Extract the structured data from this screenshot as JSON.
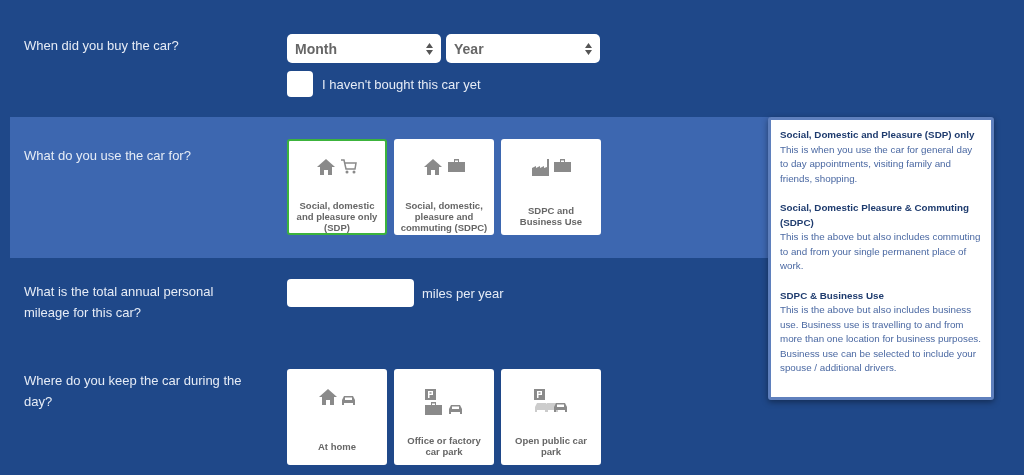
{
  "questions": [
    {
      "kind": "date",
      "label": "When did you buy the car?",
      "highlighted": false,
      "selects": [
        {
          "value": "Month"
        },
        {
          "value": "Year"
        }
      ],
      "checkbox": {
        "label": "I haven't bought this car yet",
        "checked": false
      }
    },
    {
      "kind": "cards",
      "label": "What do you use the car for?",
      "highlighted": true,
      "options": [
        {
          "label": "Social, domestic and pleasure only (SDP)",
          "selected": true
        },
        {
          "label": "Social, domestic, pleasure and commuting (SDPC)",
          "selected": false
        },
        {
          "label": "SDPC and Business Use",
          "selected": false
        }
      ]
    },
    {
      "kind": "number",
      "label": "What is the total annual personal mileage for this car?",
      "highlighted": false,
      "unit": "miles per year"
    },
    {
      "kind": "cards",
      "label": "Where do you keep the car during the day?",
      "highlighted": false,
      "options": [
        {
          "label": "At home",
          "selected": false
        },
        {
          "label": "Office or factory car park",
          "selected": false
        },
        {
          "label": "Open public car park",
          "selected": false
        }
      ]
    }
  ],
  "help_panel": {
    "sections": [
      {
        "title": "Social, Domestic and Pleasure (SDP) only",
        "text": "This is when you use the car for general day to day appointments, visiting family and friends, shopping."
      },
      {
        "title": "Social, Domestic Pleasure & Commuting (SDPC)",
        "text": "This is the above but also includes commuting to and from your single permanent place of work."
      },
      {
        "title": "SDPC & Business Use",
        "text": "This is the above but also includes business use. Business use is travelling to and from more than one location for business purposes. Business use can be selected to include your spouse / additional drivers."
      }
    ]
  }
}
